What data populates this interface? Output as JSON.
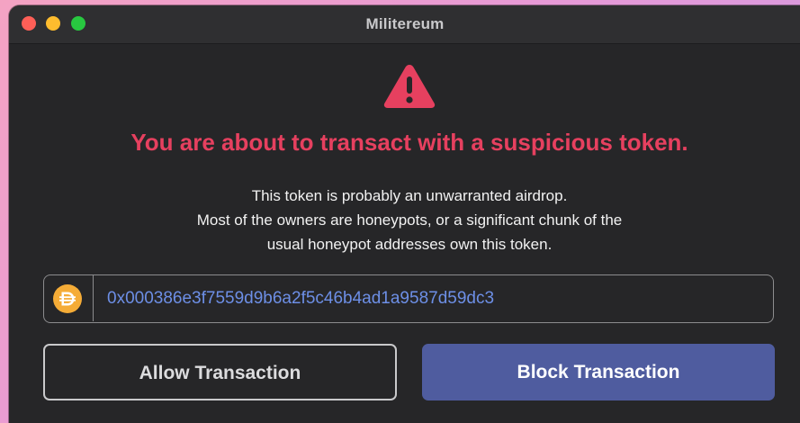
{
  "window": {
    "title": "Militereum"
  },
  "alert": {
    "headline": "You are about to transact with a suspicious token.",
    "description_lines": [
      "This token is probably an unwarranted airdrop.",
      "Most of the owners are honeypots, or a significant chunk of the",
      "usual honeypot addresses own this token."
    ],
    "icon": "warning-triangle-icon",
    "accent_color": "#e6405f"
  },
  "token": {
    "icon": "dai-token-icon",
    "address": "0x000386e3f7559d9b6a2f5c46b4ad1a9587d59dc3"
  },
  "actions": {
    "allow_label": "Allow Transaction",
    "block_label": "Block Transaction"
  }
}
